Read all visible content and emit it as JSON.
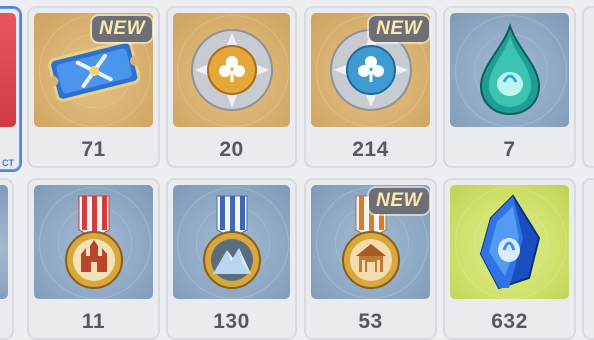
{
  "inventory": {
    "row1": [
      {
        "count": "",
        "tile": "red",
        "icon": "partial-item-icon",
        "badge": "",
        "selected_text": "CT"
      },
      {
        "count": "71",
        "tile": "gold",
        "icon": "crossed-swords-ticket-icon",
        "badge": "NEW"
      },
      {
        "count": "20",
        "tile": "gold",
        "icon": "gold-clover-coin-icon",
        "badge": ""
      },
      {
        "count": "214",
        "tile": "gold",
        "icon": "blue-clover-coin-icon",
        "badge": "NEW"
      },
      {
        "count": "7",
        "tile": "blue",
        "icon": "teal-crystal-drop-icon",
        "badge": ""
      }
    ],
    "row2": [
      {
        "count": "11",
        "tile": "blue",
        "icon": "red-ribbon-castle-medal-icon",
        "badge": ""
      },
      {
        "count": "130",
        "tile": "blue",
        "icon": "blue-ribbon-mountain-medal-icon",
        "badge": ""
      },
      {
        "count": "53",
        "tile": "blue",
        "icon": "orange-ribbon-temple-medal-icon",
        "badge": "NEW"
      },
      {
        "count": "632",
        "tile": "green",
        "icon": "blue-crystal-shard-icon",
        "badge": ""
      }
    ]
  },
  "colors": {
    "accent_selected": "#4f86e6",
    "badge_text": "#fbe9b0",
    "count_text": "#545a61"
  }
}
